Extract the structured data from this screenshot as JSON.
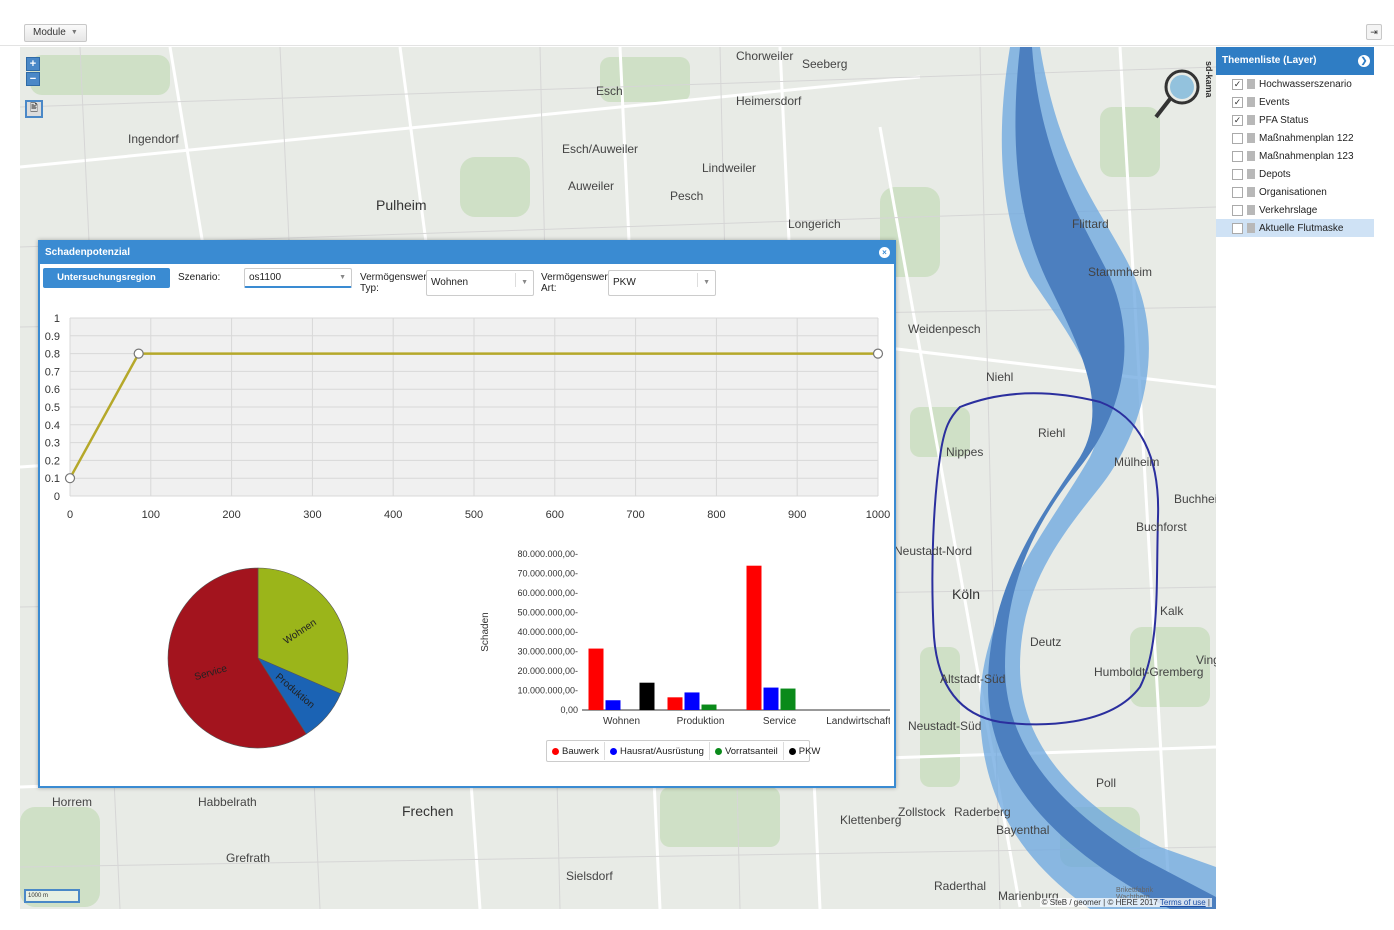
{
  "toolbar": {
    "module_label": "Module",
    "caret": "▼",
    "logout_icon": "exit-icon",
    "logout_glyph": "⇥"
  },
  "map": {
    "zoom_in": "+",
    "zoom_out": "−",
    "print_glyph": "🖹",
    "logo_text": "sd-kama",
    "scale_text": "1000 m",
    "attribution_text": "© SteB / geomer | © HERE 2017",
    "terms_link": "Terms of use",
    "attribution_end": " |",
    "labels": [
      {
        "text": "Chorweiler",
        "cls": "big"
      },
      {
        "text": "Seeberg",
        "cls": "big"
      },
      {
        "text": "Esch",
        "cls": "big"
      },
      {
        "text": "Heimersdorf",
        "cls": "big"
      },
      {
        "text": "Ingendorf",
        "cls": "big"
      },
      {
        "text": "Esch/Auweiler",
        "cls": "big"
      },
      {
        "text": "Lindweiler",
        "cls": "big"
      },
      {
        "text": "Auweiler",
        "cls": "big"
      },
      {
        "text": "Pesch",
        "cls": "big"
      },
      {
        "text": "Pulheim",
        "cls": "xl"
      },
      {
        "text": "Longerich",
        "cls": "big"
      },
      {
        "text": "Flittard",
        "cls": "big"
      },
      {
        "text": "Stammheim",
        "cls": "big"
      },
      {
        "text": "Weidenpesch",
        "cls": "big"
      },
      {
        "text": "Niehl",
        "cls": "big"
      },
      {
        "text": "Riehl",
        "cls": "big"
      },
      {
        "text": "Nippes",
        "cls": "big"
      },
      {
        "text": "Mülheim",
        "cls": "big"
      },
      {
        "text": "Buchheim",
        "cls": "big"
      },
      {
        "text": "Buchforst",
        "cls": "big"
      },
      {
        "text": "Neustadt-Nord",
        "cls": "big"
      },
      {
        "text": "Köln",
        "cls": "xl"
      },
      {
        "text": "Deutz",
        "cls": "big"
      },
      {
        "text": "Kalk",
        "cls": "big"
      },
      {
        "text": "Vingst",
        "cls": "big"
      },
      {
        "text": "Altstadt-Süd",
        "cls": "big"
      },
      {
        "text": "Humboldt-Gremberg",
        "cls": "big"
      },
      {
        "text": "Neustadt-Süd",
        "cls": "big"
      },
      {
        "text": "Poll",
        "cls": "big"
      },
      {
        "text": "Horrem",
        "cls": "big"
      },
      {
        "text": "Habbelrath",
        "cls": "big"
      },
      {
        "text": "Frechen",
        "cls": "xl"
      },
      {
        "text": "Zollstock",
        "cls": "big"
      },
      {
        "text": "Klettenberg",
        "cls": "big"
      },
      {
        "text": "Raderberg",
        "cls": "big"
      },
      {
        "text": "Bayenthal",
        "cls": "big"
      },
      {
        "text": "Grefrath",
        "cls": "big"
      },
      {
        "text": "Sielsdorf",
        "cls": "big"
      },
      {
        "text": "Raderthal",
        "cls": "big"
      },
      {
        "text": "Marienburg",
        "cls": "big"
      },
      {
        "text": "Brikettfabrik Wachtberg",
        "cls": "small"
      }
    ]
  },
  "layers": {
    "title": "Themenliste (Layer)",
    "arrow": "❯",
    "items": [
      {
        "label": "Hochwasserszenario",
        "checked": "✓"
      },
      {
        "label": "Events",
        "checked": "✓"
      },
      {
        "label": "PFA Status",
        "checked": "✓"
      },
      {
        "label": "Maßnahmenplan 122",
        "checked": ""
      },
      {
        "label": "Maßnahmenplan 123",
        "checked": ""
      },
      {
        "label": "Depots",
        "checked": ""
      },
      {
        "label": "Organisationen",
        "checked": ""
      },
      {
        "label": "Verkehrslage",
        "checked": ""
      },
      {
        "label": "Aktuelle Flutmaske",
        "checked": ""
      }
    ]
  },
  "dialog": {
    "title": "Schadenpotenzial",
    "close": "×",
    "draw_button": "Untersuchungsregion zeichnen",
    "scenario_label": "Szenario:",
    "scenario_value": "os1100",
    "type_label_1": "Vermögenswert-",
    "type_label_2": "Typ:",
    "type_value": "Wohnen",
    "kind_label_1": "Vermögenswert-",
    "kind_label_2": "Art:",
    "kind_value": "PKW",
    "caret": "▼"
  },
  "chart_data": [
    {
      "type": "line",
      "x": [
        0,
        85,
        1000
      ],
      "y": [
        0.1,
        0.8,
        0.8
      ],
      "xlim": [
        0,
        1000
      ],
      "ylim": [
        0,
        1
      ],
      "xticks": [
        0,
        100,
        200,
        300,
        400,
        500,
        600,
        700,
        800,
        900,
        1000
      ],
      "yticks": [
        "0",
        "0.1",
        "0.2",
        "0.3",
        "0.4",
        "0.5",
        "0.6",
        "0.7",
        "0.8",
        "0.9",
        "1"
      ],
      "grid": true,
      "color": "#b5a82a"
    },
    {
      "type": "pie",
      "labels": [
        "Wohnen",
        "Produktion",
        "Service"
      ],
      "values": [
        31.5,
        9.5,
        59
      ],
      "colors": [
        "#9bb51a",
        "#1b63b4",
        "#a3141e"
      ]
    },
    {
      "type": "bar",
      "ylabel": "Schaden",
      "categories": [
        "Wohnen",
        "Produktion",
        "Service",
        "Landwirtschaft"
      ],
      "ylim": [
        0,
        80000000
      ],
      "ytick_labels": [
        "0,00",
        "10.000.000,00-",
        "20.000.000,00-",
        "30.000.000,00-",
        "40.000.000,00-",
        "50.000.000,00-",
        "60.000.000,00-",
        "70.000.000,00-",
        "80.000.000,00-"
      ],
      "series": [
        {
          "name": "Bauwerk",
          "color": "#ff0000",
          "values": [
            31500000,
            6500000,
            74000000,
            0
          ]
        },
        {
          "name": "Hausrat/Ausrüstung",
          "color": "#0000ff",
          "values": [
            5000000,
            9000000,
            11500000,
            0
          ]
        },
        {
          "name": "Vorratsanteil",
          "color": "#0a8a1a",
          "values": [
            0,
            2800000,
            11000000,
            0
          ]
        },
        {
          "name": "PKW",
          "color": "#000000",
          "values": [
            14000000,
            0,
            0,
            0
          ]
        }
      ],
      "legend": "bottom"
    }
  ]
}
